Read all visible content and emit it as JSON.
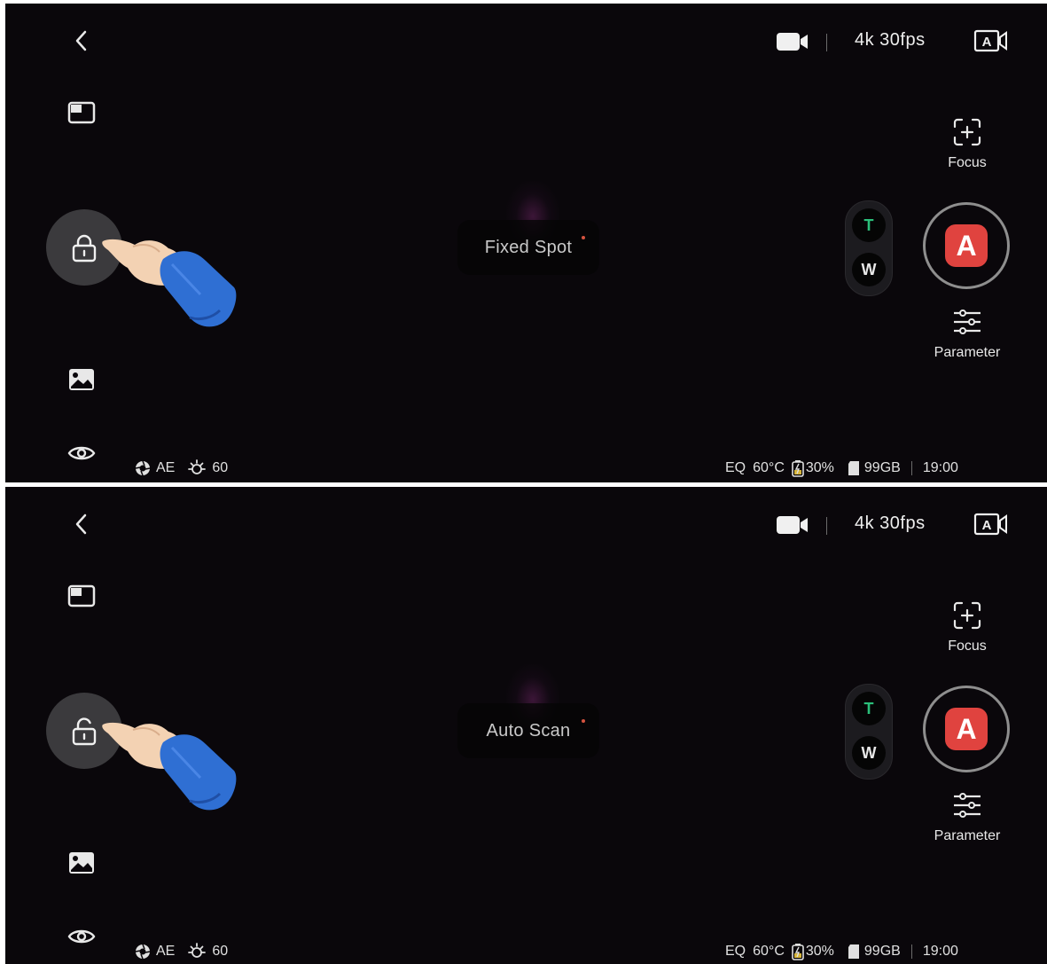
{
  "panels": [
    {
      "mode_label": "Fixed Spot",
      "lock_state": "locked",
      "top_bar": {
        "resolution": "4k 30fps"
      },
      "right": {
        "focus_label": "Focus",
        "zoom_tele": "T",
        "zoom_wide": "W",
        "shutter_mode": "A",
        "parameter_label": "Parameter"
      },
      "status_left": {
        "exposure": "AE",
        "brightness": "60"
      },
      "status_right": {
        "eq": "EQ",
        "temperature": "60°C",
        "battery": "30%",
        "storage": "99GB",
        "time": "19:00"
      }
    },
    {
      "mode_label": "Auto Scan",
      "lock_state": "unlocked",
      "top_bar": {
        "resolution": "4k 30fps"
      },
      "right": {
        "focus_label": "Focus",
        "zoom_tele": "T",
        "zoom_wide": "W",
        "shutter_mode": "A",
        "parameter_label": "Parameter"
      },
      "status_left": {
        "exposure": "AE",
        "brightness": "60"
      },
      "status_right": {
        "eq": "EQ",
        "temperature": "60°C",
        "battery": "30%",
        "storage": "99GB",
        "time": "19:00"
      }
    }
  ],
  "icons": {
    "left_column": [
      "back-icon",
      "layout-icon",
      "lock-icon",
      "gallery-icon",
      "eye-icon"
    ],
    "top_bar": [
      "video-camera-icon",
      "auto-video-icon"
    ],
    "right_column": [
      "focus-icon",
      "parameter-icon"
    ]
  },
  "colors": {
    "background": "#0a070b",
    "shutter_red": "#e0433f",
    "tele_green": "#2bbf7a",
    "hand_sleeve": "#2f6fd3",
    "hand_skin": "#f3d2b3"
  }
}
